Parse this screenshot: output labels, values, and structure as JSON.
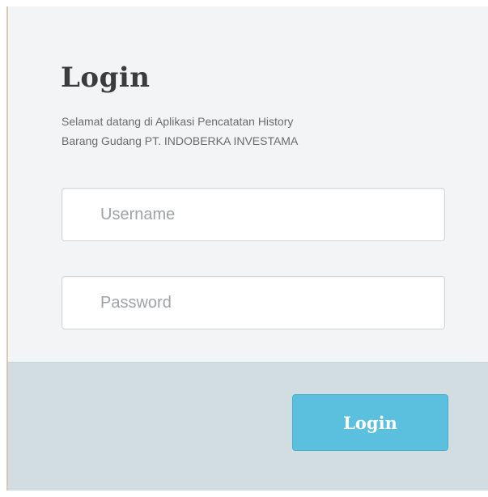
{
  "login_form": {
    "title": "Login",
    "subtitle": "Selamat datang di Aplikasi Pencatatan History\nBarang Gudang PT. INDOBERKA INVESTAMA",
    "username": {
      "value": "",
      "placeholder": "Username"
    },
    "password": {
      "value": "",
      "placeholder": "Password"
    },
    "submit_label": "Login"
  },
  "colors": {
    "top_background": "#f3f4f5",
    "footer_background": "#d2dde1",
    "button_background": "#5bc0de",
    "button_text": "#ffffff",
    "title_text": "#3b3b3b",
    "placeholder_text": "#9ea3a7"
  }
}
